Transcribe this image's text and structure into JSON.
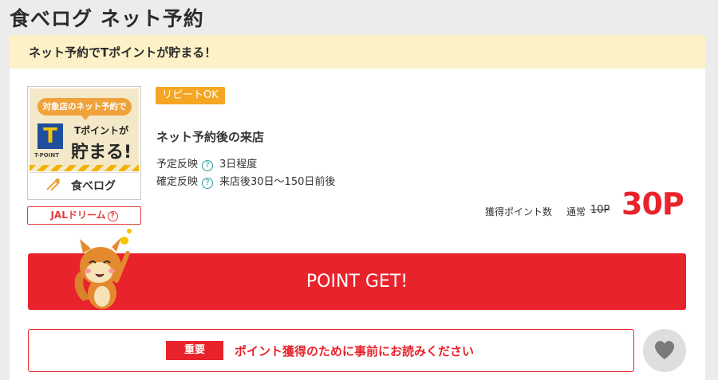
{
  "header": {
    "title": "食べログ ネット予約"
  },
  "banner": {
    "text": "ネット予約でTポイントが貯まる！"
  },
  "logo": {
    "bubble": "対象店のネット予約で",
    "tpoint_letter": "T",
    "tpoint_caption": "T-POINT",
    "slogan_line1": "Tポイントが",
    "slogan_line2": "貯まる!",
    "brand": "食べログ"
  },
  "jal": {
    "label": "JALドリーム",
    "help": "?"
  },
  "offer": {
    "repeat_tag": "リピートOK",
    "condition": "ネット予約後の来店",
    "details": [
      {
        "label": "予定反映",
        "help": "?",
        "value": "3日程度"
      },
      {
        "label": "確定反映",
        "help": "?",
        "value": "来店後30日〜150日前後"
      }
    ]
  },
  "points": {
    "label": "獲得ポイント数",
    "normal_label": "通常",
    "normal_value": "10P",
    "value": "30P"
  },
  "cta": {
    "label": "POINT GET!"
  },
  "notice": {
    "tag": "重要",
    "text": "ポイント獲得のために事前にお読みください"
  },
  "colors": {
    "accent_red": "#e8232b",
    "banner_yellow": "#fdf1c7",
    "repeat_orange": "#f5a623",
    "help_teal": "#2a9aa5"
  },
  "icons": {
    "help": "question-circle-icon",
    "favorite": "heart-icon",
    "mascot": "squirrel-mascot-icon"
  }
}
